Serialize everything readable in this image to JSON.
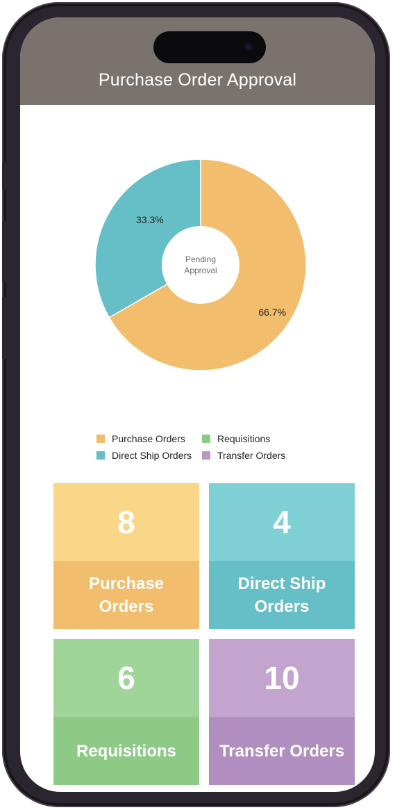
{
  "header": {
    "title": "Purchase Order Approval"
  },
  "chart_data": {
    "type": "pie",
    "center_label": [
      "Pending",
      "Approval"
    ],
    "slices": [
      {
        "name": "Purchase Orders",
        "value": 66.7,
        "label": "66.7%",
        "color": "#f2bd6c"
      },
      {
        "name": "Direct Ship Orders",
        "value": 33.3,
        "label": "33.3%",
        "color": "#66bfc7"
      }
    ],
    "legend_placement": "bottom"
  },
  "legend": [
    {
      "label": "Purchase Orders",
      "color": "#f2bd6c"
    },
    {
      "label": "Requisitions",
      "color": "#8dca86"
    },
    {
      "label": "Direct Ship Orders",
      "color": "#66bfc7"
    },
    {
      "label": "Transfer Orders",
      "color": "#bb98c5"
    }
  ],
  "tiles": [
    {
      "count": "8",
      "label": "Purchase Orders",
      "top_color": "#f9d688",
      "bottom_color": "#f2bd6c",
      "icon": ""
    },
    {
      "count": "4",
      "label": "Direct Ship Orders",
      "top_color": "#7fd0d4",
      "bottom_color": "#66bfc7",
      "icon": ""
    },
    {
      "count": "6",
      "label": "Requisitions",
      "top_color": "#9fd598",
      "bottom_color": "#8dca86",
      "icon": ""
    },
    {
      "count": "10",
      "label": "Transfer Orders",
      "top_color": "#c3a4cf",
      "bottom_color": "#b08ebf",
      "icon": ""
    }
  ]
}
